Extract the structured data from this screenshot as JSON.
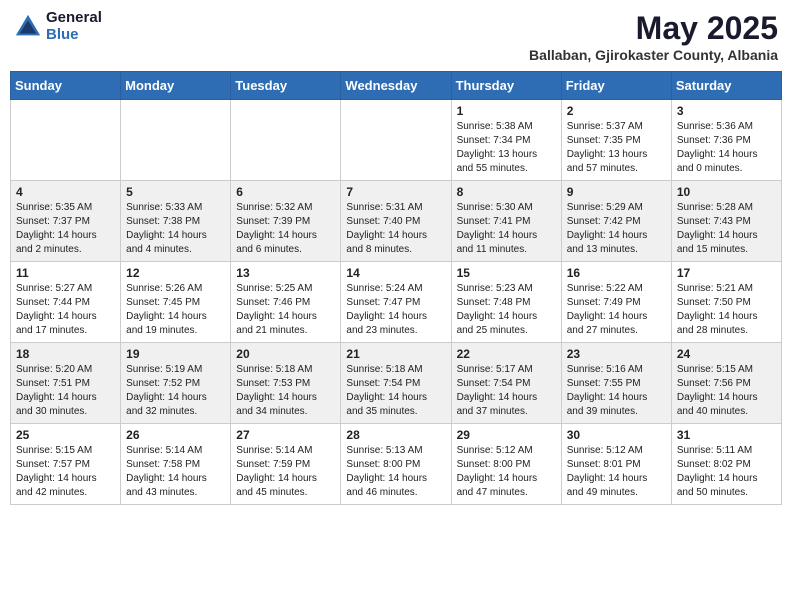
{
  "header": {
    "logo_general": "General",
    "logo_blue": "Blue",
    "title": "May 2025",
    "location": "Ballaban, Gjirokaster County, Albania"
  },
  "weekdays": [
    "Sunday",
    "Monday",
    "Tuesday",
    "Wednesday",
    "Thursday",
    "Friday",
    "Saturday"
  ],
  "weeks": [
    [
      {
        "day": "",
        "info": ""
      },
      {
        "day": "",
        "info": ""
      },
      {
        "day": "",
        "info": ""
      },
      {
        "day": "",
        "info": ""
      },
      {
        "day": "1",
        "info": "Sunrise: 5:38 AM\nSunset: 7:34 PM\nDaylight: 13 hours\nand 55 minutes."
      },
      {
        "day": "2",
        "info": "Sunrise: 5:37 AM\nSunset: 7:35 PM\nDaylight: 13 hours\nand 57 minutes."
      },
      {
        "day": "3",
        "info": "Sunrise: 5:36 AM\nSunset: 7:36 PM\nDaylight: 14 hours\nand 0 minutes."
      }
    ],
    [
      {
        "day": "4",
        "info": "Sunrise: 5:35 AM\nSunset: 7:37 PM\nDaylight: 14 hours\nand 2 minutes."
      },
      {
        "day": "5",
        "info": "Sunrise: 5:33 AM\nSunset: 7:38 PM\nDaylight: 14 hours\nand 4 minutes."
      },
      {
        "day": "6",
        "info": "Sunrise: 5:32 AM\nSunset: 7:39 PM\nDaylight: 14 hours\nand 6 minutes."
      },
      {
        "day": "7",
        "info": "Sunrise: 5:31 AM\nSunset: 7:40 PM\nDaylight: 14 hours\nand 8 minutes."
      },
      {
        "day": "8",
        "info": "Sunrise: 5:30 AM\nSunset: 7:41 PM\nDaylight: 14 hours\nand 11 minutes."
      },
      {
        "day": "9",
        "info": "Sunrise: 5:29 AM\nSunset: 7:42 PM\nDaylight: 14 hours\nand 13 minutes."
      },
      {
        "day": "10",
        "info": "Sunrise: 5:28 AM\nSunset: 7:43 PM\nDaylight: 14 hours\nand 15 minutes."
      }
    ],
    [
      {
        "day": "11",
        "info": "Sunrise: 5:27 AM\nSunset: 7:44 PM\nDaylight: 14 hours\nand 17 minutes."
      },
      {
        "day": "12",
        "info": "Sunrise: 5:26 AM\nSunset: 7:45 PM\nDaylight: 14 hours\nand 19 minutes."
      },
      {
        "day": "13",
        "info": "Sunrise: 5:25 AM\nSunset: 7:46 PM\nDaylight: 14 hours\nand 21 minutes."
      },
      {
        "day": "14",
        "info": "Sunrise: 5:24 AM\nSunset: 7:47 PM\nDaylight: 14 hours\nand 23 minutes."
      },
      {
        "day": "15",
        "info": "Sunrise: 5:23 AM\nSunset: 7:48 PM\nDaylight: 14 hours\nand 25 minutes."
      },
      {
        "day": "16",
        "info": "Sunrise: 5:22 AM\nSunset: 7:49 PM\nDaylight: 14 hours\nand 27 minutes."
      },
      {
        "day": "17",
        "info": "Sunrise: 5:21 AM\nSunset: 7:50 PM\nDaylight: 14 hours\nand 28 minutes."
      }
    ],
    [
      {
        "day": "18",
        "info": "Sunrise: 5:20 AM\nSunset: 7:51 PM\nDaylight: 14 hours\nand 30 minutes."
      },
      {
        "day": "19",
        "info": "Sunrise: 5:19 AM\nSunset: 7:52 PM\nDaylight: 14 hours\nand 32 minutes."
      },
      {
        "day": "20",
        "info": "Sunrise: 5:18 AM\nSunset: 7:53 PM\nDaylight: 14 hours\nand 34 minutes."
      },
      {
        "day": "21",
        "info": "Sunrise: 5:18 AM\nSunset: 7:54 PM\nDaylight: 14 hours\nand 35 minutes."
      },
      {
        "day": "22",
        "info": "Sunrise: 5:17 AM\nSunset: 7:54 PM\nDaylight: 14 hours\nand 37 minutes."
      },
      {
        "day": "23",
        "info": "Sunrise: 5:16 AM\nSunset: 7:55 PM\nDaylight: 14 hours\nand 39 minutes."
      },
      {
        "day": "24",
        "info": "Sunrise: 5:15 AM\nSunset: 7:56 PM\nDaylight: 14 hours\nand 40 minutes."
      }
    ],
    [
      {
        "day": "25",
        "info": "Sunrise: 5:15 AM\nSunset: 7:57 PM\nDaylight: 14 hours\nand 42 minutes."
      },
      {
        "day": "26",
        "info": "Sunrise: 5:14 AM\nSunset: 7:58 PM\nDaylight: 14 hours\nand 43 minutes."
      },
      {
        "day": "27",
        "info": "Sunrise: 5:14 AM\nSunset: 7:59 PM\nDaylight: 14 hours\nand 45 minutes."
      },
      {
        "day": "28",
        "info": "Sunrise: 5:13 AM\nSunset: 8:00 PM\nDaylight: 14 hours\nand 46 minutes."
      },
      {
        "day": "29",
        "info": "Sunrise: 5:12 AM\nSunset: 8:00 PM\nDaylight: 14 hours\nand 47 minutes."
      },
      {
        "day": "30",
        "info": "Sunrise: 5:12 AM\nSunset: 8:01 PM\nDaylight: 14 hours\nand 49 minutes."
      },
      {
        "day": "31",
        "info": "Sunrise: 5:11 AM\nSunset: 8:02 PM\nDaylight: 14 hours\nand 50 minutes."
      }
    ]
  ]
}
